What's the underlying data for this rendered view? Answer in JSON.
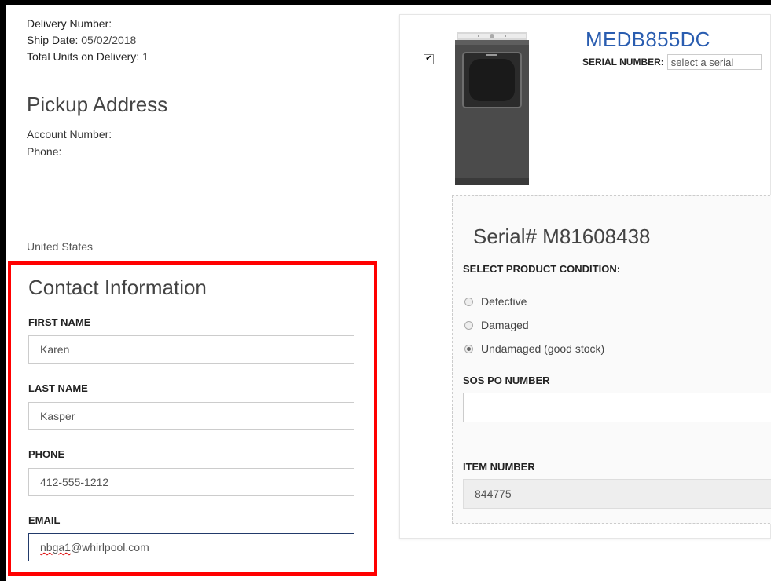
{
  "delivery": {
    "delivery_number_label": "Delivery Number:",
    "ship_date_label": "Ship Date:",
    "ship_date_value": "05/02/2018",
    "total_units_label": "Total Units on Delivery:",
    "total_units_value": "1"
  },
  "pickup": {
    "title": "Pickup Address",
    "account_number_label": "Account Number:",
    "phone_label": "Phone:",
    "country": "United States"
  },
  "contact": {
    "title": "Contact Information",
    "first_name_label": "FIRST NAME",
    "first_name_value": "Karen",
    "last_name_label": "LAST NAME",
    "last_name_value": "Kasper",
    "phone_label": "PHONE",
    "phone_value": "412-555-1212",
    "email_label": "EMAIL",
    "email_user_misspelled": "nbga1",
    "email_domain": "@whirlpool.com"
  },
  "product": {
    "model": "MEDB855DC",
    "serial_number_label": "SERIAL NUMBER:",
    "serial_select_placeholder": "select a serial",
    "selected": true,
    "serial_title": "Serial# M81608438",
    "condition_label": "SELECT PRODUCT CONDITION:",
    "conditions": [
      {
        "label": "Defective",
        "checked": false
      },
      {
        "label": "Damaged",
        "checked": false
      },
      {
        "label": "Undamaged (good stock)",
        "checked": true
      }
    ],
    "sos_po_label": "SOS PO NUMBER",
    "sos_po_value": "",
    "item_number_label": "ITEM NUMBER",
    "item_number_value": "844775"
  },
  "colors": {
    "highlight_border": "#ff0000",
    "model_link": "#2a5db0",
    "focused_input_border": "#223a6a"
  }
}
